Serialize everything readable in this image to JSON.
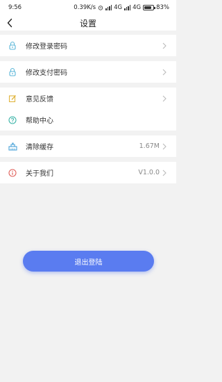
{
  "status_bar": {
    "time": "9:56",
    "network_speed": "0.39K/s",
    "network_types": [
      "4G",
      "4G"
    ],
    "battery": "83%",
    "battery_level": 0.83
  },
  "header": {
    "title": "设置"
  },
  "colors": {
    "accent": "#5a7cf0",
    "background": "#f2f2f2"
  },
  "settings": {
    "items": [
      {
        "label": "修改登录密码",
        "icon": "lock-icon"
      },
      {
        "label": "修改支付密码",
        "icon": "lock-icon"
      },
      {
        "label": "意见反馈",
        "icon": "edit-icon"
      },
      {
        "label": "帮助中心",
        "icon": "help-icon"
      },
      {
        "label": "清除缓存",
        "icon": "broom-icon",
        "value": "1.67M"
      },
      {
        "label": "关于我们",
        "icon": "info-icon",
        "value": "V1.0.0"
      }
    ]
  },
  "logout_label": "退出登陆"
}
